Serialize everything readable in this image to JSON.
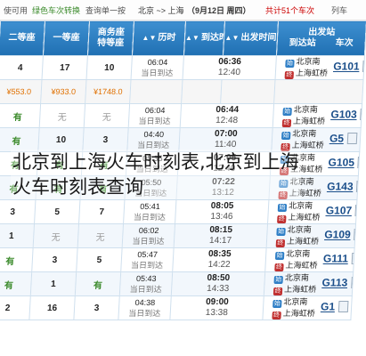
{
  "topbar": {
    "prefix": "使可用",
    "highlight": "绿色车次转换",
    "middle": "查询单一按",
    "route": "北京 ~> 上海",
    "date": "（9月12日 周四）",
    "count": "共计51个车次",
    "more": "列车"
  },
  "header": {
    "soft_sleeper": "二等座",
    "first_class": "一等座",
    "business": "商务座\n特等座",
    "duration": "历时",
    "arrival": "到达时间",
    "departure": "出发时间",
    "stations": "出发站\n到达站",
    "train": "车次",
    "arrow": "▲▼"
  },
  "rows": [
    {
      "kind": "normal",
      "second": "4",
      "first": "17",
      "business": "10",
      "dur1": "06:04",
      "dur2": "当日到达",
      "dep": "06:36",
      "arr": "12:40",
      "from": "北京南",
      "to": "上海虹桥",
      "train": "G101"
    },
    {
      "kind": "price",
      "second": "¥553.0",
      "first": "¥933.0",
      "business": "¥1748.0",
      "dur1": "",
      "dur2": "",
      "dep": "",
      "arr": "",
      "from": "",
      "to": "",
      "train": ""
    },
    {
      "kind": "normal",
      "second": "有",
      "first": "无",
      "business": "无",
      "dur1": "06:04",
      "dur2": "当日到达",
      "dep": "06:44",
      "arr": "12:48",
      "from": "北京南",
      "to": "上海虹桥",
      "train": "G103"
    },
    {
      "kind": "alt",
      "second": "有",
      "first": "10",
      "business": "3",
      "dur1": "04:40",
      "dur2": "当日到达",
      "dep": "07:00",
      "arr": "11:40",
      "from": "北京南",
      "to": "上海虹桥",
      "train": "G5"
    },
    {
      "kind": "normal",
      "second": "有",
      "first": "有",
      "business": "有",
      "dur1": "05:35",
      "dur2": "当日到达",
      "dep": "07:05",
      "arr": "12:40",
      "from": "北京南",
      "to": "上海虹桥",
      "train": "G105"
    },
    {
      "kind": "alt",
      "second": "有",
      "first": "有",
      "business": "有",
      "dur1": "05:50",
      "dur2": "当日到达",
      "dep": "07:22",
      "arr": "13:12",
      "from": "北京南",
      "to": "上海虹桥",
      "train": "G143"
    },
    {
      "kind": "normal",
      "second": "3",
      "first": "5",
      "business": "7",
      "dur1": "05:41",
      "dur2": "当日到达",
      "dep": "08:05",
      "arr": "13:46",
      "from": "北京南",
      "to": "上海虹桥",
      "train": "G107"
    },
    {
      "kind": "alt",
      "second": "1",
      "first": "无",
      "business": "无",
      "dur1": "06:02",
      "dur2": "当日到达",
      "dep": "08:15",
      "arr": "14:17",
      "from": "北京南",
      "to": "上海虹桥",
      "train": "G109"
    },
    {
      "kind": "normal",
      "second": "有",
      "first": "3",
      "business": "5",
      "dur1": "05:47",
      "dur2": "当日到达",
      "dep": "08:35",
      "arr": "14:22",
      "from": "北京南",
      "to": "上海虹桥",
      "train": "G111"
    },
    {
      "kind": "alt",
      "second": "有",
      "first": "1",
      "business": "有",
      "dur1": "05:43",
      "dur2": "当日到达",
      "dep": "08:50",
      "arr": "14:33",
      "from": "北京南",
      "to": "上海虹桥",
      "train": "G113"
    },
    {
      "kind": "normal",
      "second": "2",
      "first": "16",
      "business": "3",
      "dur1": "04:38",
      "dur2": "当日到达",
      "dep": "09:00",
      "arr": "13:38",
      "from": "北京南",
      "to": "上海虹桥",
      "train": "G1"
    }
  ],
  "caption": {
    "line1": "北京到上海火车时刻表,北京到上海",
    "line2": "火车时刻表查询"
  },
  "colors": {
    "header_blue": "#2f80c4",
    "seat_available_green": "#3a8a2a",
    "price_orange": "#e07000",
    "train_link_blue": "#1a4e8a"
  }
}
